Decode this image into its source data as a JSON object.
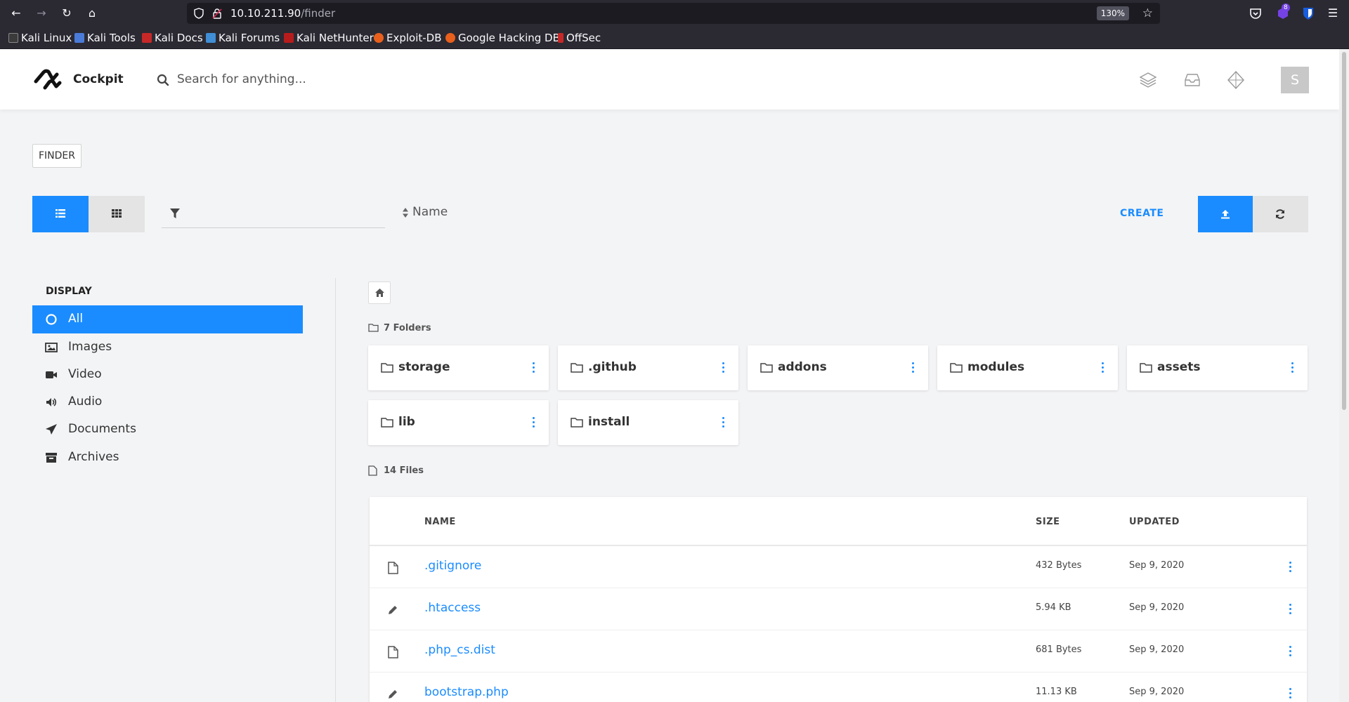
{
  "browser": {
    "url_host": "10.10.211.90",
    "url_path": "/finder",
    "zoom": "130%",
    "extension_badge": "8",
    "bookmarks": [
      "Kali Linux",
      "Kali Tools",
      "Kali Docs",
      "Kali Forums",
      "Kali NetHunter",
      "Exploit-DB",
      "Google Hacking DB",
      "OffSec"
    ]
  },
  "header": {
    "brand": "Cockpit",
    "search_placeholder": "Search for anything...",
    "avatar_letter": "S"
  },
  "toolbar": {
    "badge": "FINDER",
    "sort_label": "Name",
    "create_label": "CREATE"
  },
  "sidebar": {
    "title": "DISPLAY",
    "items": [
      {
        "label": "All",
        "icon": "circle-icon",
        "active": true
      },
      {
        "label": "Images",
        "icon": "image-icon"
      },
      {
        "label": "Video",
        "icon": "video-camera-icon"
      },
      {
        "label": "Audio",
        "icon": "volume-icon"
      },
      {
        "label": "Documents",
        "icon": "paper-plane-icon"
      },
      {
        "label": "Archives",
        "icon": "archive-box-icon"
      }
    ]
  },
  "folders": {
    "count_label": "7 Folders",
    "items": [
      "storage",
      ".github",
      "addons",
      "modules",
      "assets",
      "lib",
      "install"
    ]
  },
  "files": {
    "count_label": "14 Files",
    "columns": {
      "name": "NAME",
      "size": "SIZE",
      "updated": "UPDATED"
    },
    "rows": [
      {
        "name": ".gitignore",
        "size": "432 Bytes",
        "updated": "Sep 9, 2020",
        "icon": "file-icon"
      },
      {
        "name": ".htaccess",
        "size": "5.94 KB",
        "updated": "Sep 9, 2020",
        "icon": "pencil-icon"
      },
      {
        "name": ".php_cs.dist",
        "size": "681 Bytes",
        "updated": "Sep 9, 2020",
        "icon": "file-icon"
      },
      {
        "name": "bootstrap.php",
        "size": "11.13 KB",
        "updated": "Sep 9, 2020",
        "icon": "pencil-icon"
      }
    ]
  },
  "colors": {
    "accent": "#1a8cff",
    "chrome": "#2b2a33"
  }
}
